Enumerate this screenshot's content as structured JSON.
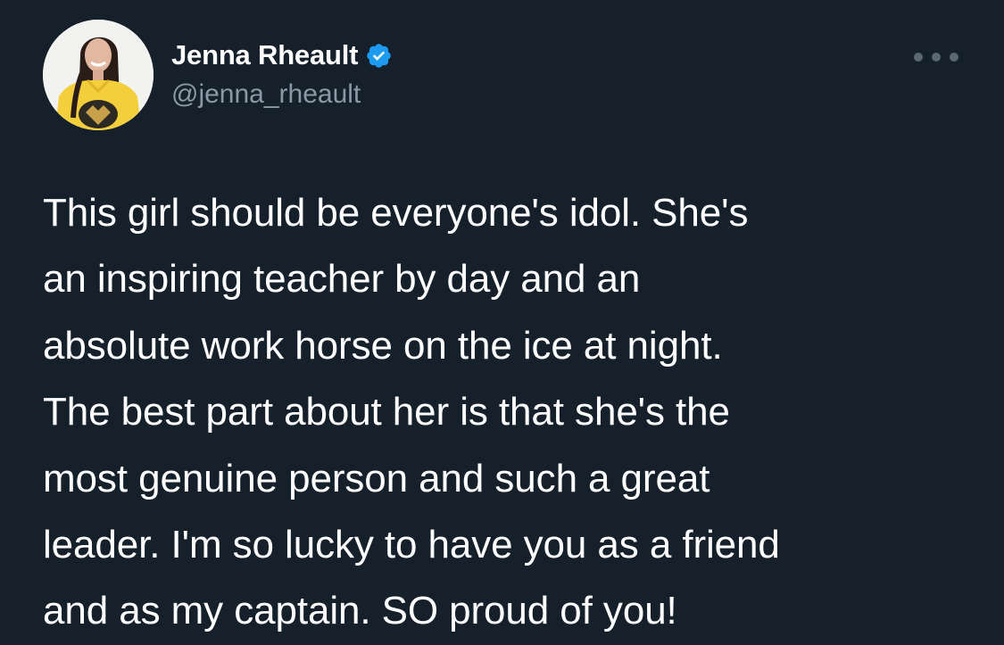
{
  "author": {
    "display_name": "Jenna Rheault",
    "handle": "@jenna_rheault",
    "verified": true,
    "avatar_icon": "profile-photo"
  },
  "menu": {
    "icon": "more-horizontal-icon"
  },
  "tweet": {
    "lines": [
      "This girl should be everyone's idol. She's",
      "an inspiring teacher by day and an",
      "absolute work horse on the ice at night.",
      "The best part about her is that she's the",
      "most genuine person and such a great",
      "leader. I'm so lucky to have you as a friend",
      "and as my captain. SO proud of you!"
    ]
  },
  "colors": {
    "background": "#15202b",
    "text": "#ffffff",
    "secondary_text": "#8b98a5",
    "verified_badge": "#1d9bf0"
  }
}
